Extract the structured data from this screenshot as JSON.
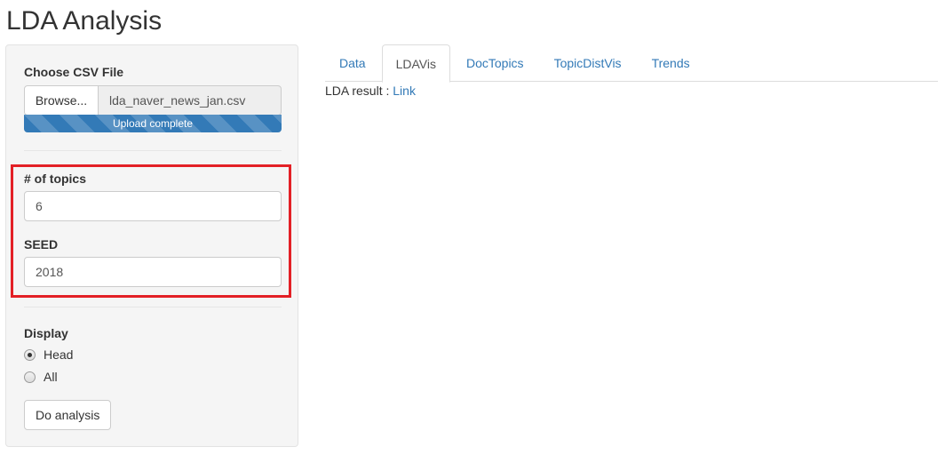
{
  "page": {
    "title": "LDA Analysis"
  },
  "sidebar": {
    "file_input": {
      "label": "Choose CSV File",
      "browse_label": "Browse...",
      "file_name": "lda_naver_news_jan.csv",
      "progress_text": "Upload complete",
      "progress_percent": 100
    },
    "topics": {
      "label": "# of topics",
      "value": "6"
    },
    "seed": {
      "label": "SEED",
      "value": "2018"
    },
    "display": {
      "label": "Display",
      "options": [
        {
          "label": "Head",
          "checked": true
        },
        {
          "label": "All",
          "checked": false
        }
      ]
    },
    "do_analysis_label": "Do analysis"
  },
  "tabs": [
    {
      "label": "Data",
      "active": false
    },
    {
      "label": "LDAVis",
      "active": true
    },
    {
      "label": "DocTopics",
      "active": false
    },
    {
      "label": "TopicDistVis",
      "active": false
    },
    {
      "label": "Trends",
      "active": false
    }
  ],
  "main": {
    "result_label": "LDA result : ",
    "result_link": "Link"
  },
  "colors": {
    "accent": "#337ab7",
    "highlight": "#e32026",
    "sidebar_bg": "#f5f5f5"
  }
}
